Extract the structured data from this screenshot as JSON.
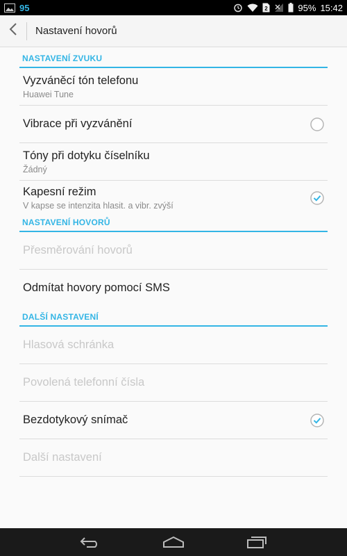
{
  "status_bar": {
    "notification_count": "95",
    "battery": "95%",
    "time": "15:42",
    "icons": [
      "image-icon",
      "alarm-icon",
      "wifi-icon",
      "sim-icon",
      "signal-off-icon",
      "battery-icon"
    ]
  },
  "action_bar": {
    "title": "Nastavení hovorů",
    "back_icon": "back-chevron-icon"
  },
  "sections": {
    "sound": {
      "header": "NASTAVENÍ ZVUKU"
    },
    "calls": {
      "header": "NASTAVENÍ HOVORŮ"
    },
    "other": {
      "header": "DALŠÍ NASTAVENÍ"
    }
  },
  "prefs": {
    "ringtone": {
      "title": "Vyzváněcí tón telefonu",
      "summary": "Huawei Tune"
    },
    "vibrate": {
      "title": "Vibrace při vyzvánění",
      "checked": false
    },
    "dialpad_tones": {
      "title": "Tóny při dotyku číselníku",
      "summary": "Žádný"
    },
    "pocket_mode": {
      "title": "Kapesní režim",
      "summary": "V kapse se intenzita hlasit. a vibr. zvýší",
      "checked": true
    },
    "call_forwarding": {
      "title": "Přesměrování hovorů",
      "enabled": false
    },
    "reject_sms": {
      "title": "Odmítat hovory pomocí SMS"
    },
    "voicemail": {
      "title": "Hlasová schránka",
      "enabled": false
    },
    "fdn": {
      "title": "Povolená telefonní čísla",
      "enabled": false
    },
    "proximity": {
      "title": "Bezdotykový snímač",
      "checked": true
    },
    "more_settings": {
      "title": "Další nastavení",
      "enabled": false
    }
  },
  "colors": {
    "accent": "#33b5e5",
    "disabled_text": "#c8c8c8"
  },
  "nav_bar": {
    "icons": [
      "back-icon",
      "home-icon",
      "recents-icon"
    ]
  }
}
